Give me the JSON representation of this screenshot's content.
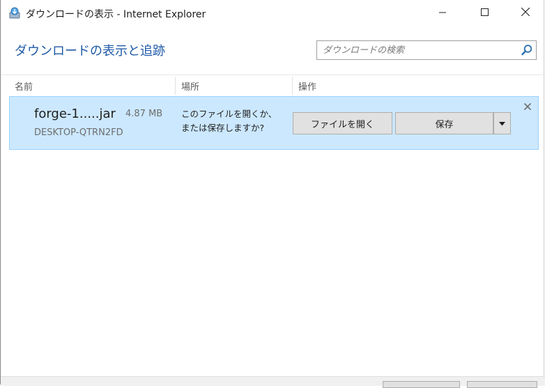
{
  "window": {
    "title": "ダウンロードの表示 - Internet Explorer",
    "minimize_icon": "minimize-icon",
    "maximize_icon": "maximize-icon",
    "close_icon": "close-icon"
  },
  "header": {
    "heading": "ダウンロードの表示と追跡",
    "search_placeholder": "ダウンロードの検索",
    "search_icon": "search-icon"
  },
  "columns": {
    "name": "名前",
    "location": "場所",
    "actions": "操作"
  },
  "downloads": [
    {
      "file_name": "forge-1.....jar",
      "size": "4.87 MB",
      "source": "DESKTOP-QTRN2FD",
      "message": "このファイルを開くか、または保存しますか?",
      "open_label": "ファイルを開く",
      "save_label": "保存",
      "dropdown_icon": "triangle-down-icon",
      "dismiss_icon": "close-icon"
    }
  ],
  "colors": {
    "accent": "#1f5aa8",
    "row_selected_bg": "#cce8ff",
    "row_selected_border": "#99d1ff",
    "button_bg": "#e1e1e1"
  }
}
